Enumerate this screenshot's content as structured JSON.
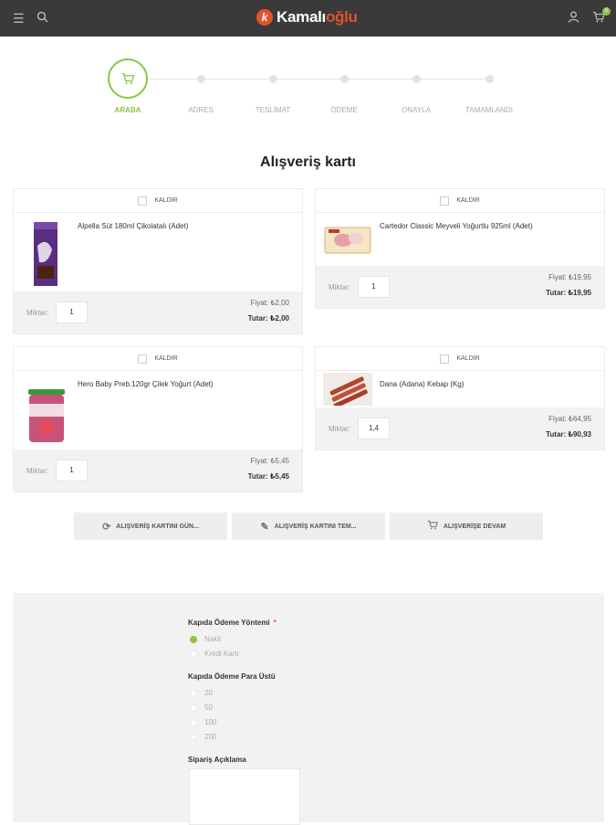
{
  "header": {
    "menu_icon": "menu-icon",
    "search_icon": "search-icon",
    "logo_mark": "k",
    "logo_primary": "Kamalı",
    "logo_accent": "oğlu",
    "user_icon": "user-icon",
    "cart_icon": "cart-icon",
    "cart_count": "0"
  },
  "steps": [
    {
      "label": "ARABA",
      "active": true
    },
    {
      "label": "ADRES",
      "active": false
    },
    {
      "label": "TESLİMAT",
      "active": false
    },
    {
      "label": "ÖDEME",
      "active": false
    },
    {
      "label": "ONAYLA",
      "active": false
    },
    {
      "label": "TAMAMLANDI",
      "active": false
    }
  ],
  "page_title": "Alışveriş kartı",
  "cart": {
    "remove_label": "KALDIR",
    "qty_label": "Miktar:",
    "items": [
      {
        "name": "Alpella Süt 180ml Çikolatalı (Adet)",
        "qty": "1",
        "price": "Fiyat: ₺2,00",
        "total": "Tutar: ₺2,00"
      },
      {
        "name": "Cartedor Classic Meyveli Yoğurtlu 925ml (Adet)",
        "qty": "1",
        "price": "Fiyat: ₺19,95",
        "total": "Tutar: ₺19,95"
      },
      {
        "name": "Hero Baby Preb.120gr Çilek Yoğurt (Adet)",
        "qty": "1",
        "price": "Fiyat: ₺5,45",
        "total": "Tutar: ₺5,45"
      },
      {
        "name": "Dana (Adana) Kebap (Kg)",
        "qty": "1,4",
        "price": "Fiyat: ₺64,95",
        "total": "Tutar: ₺90,93"
      }
    ]
  },
  "actions": {
    "update": "ALIŞVERİŞ KARTINI GÜN...",
    "clear": "ALIŞVERİŞ KARTINI TEM...",
    "continue": "ALIŞVERİŞE DEVAM"
  },
  "checkout_form": {
    "payment_method_label": "Kapıda Ödeme Yöntemi",
    "required_mark": "*",
    "payment_options": [
      {
        "label": "Nakit",
        "selected": true
      },
      {
        "label": "Kredi Kartı",
        "selected": false
      }
    ],
    "change_label": "Kapıda Ödeme Para Üstü",
    "change_options": [
      {
        "label": "20",
        "selected": false
      },
      {
        "label": "50",
        "selected": false
      },
      {
        "label": "100",
        "selected": false
      },
      {
        "label": "200",
        "selected": false
      }
    ],
    "note_label": "Sipariş Açıklama",
    "note_value": ""
  },
  "colors": {
    "accent": "#8cc63f",
    "brand": "#e2532a",
    "topbar": "#3a3a3a"
  }
}
